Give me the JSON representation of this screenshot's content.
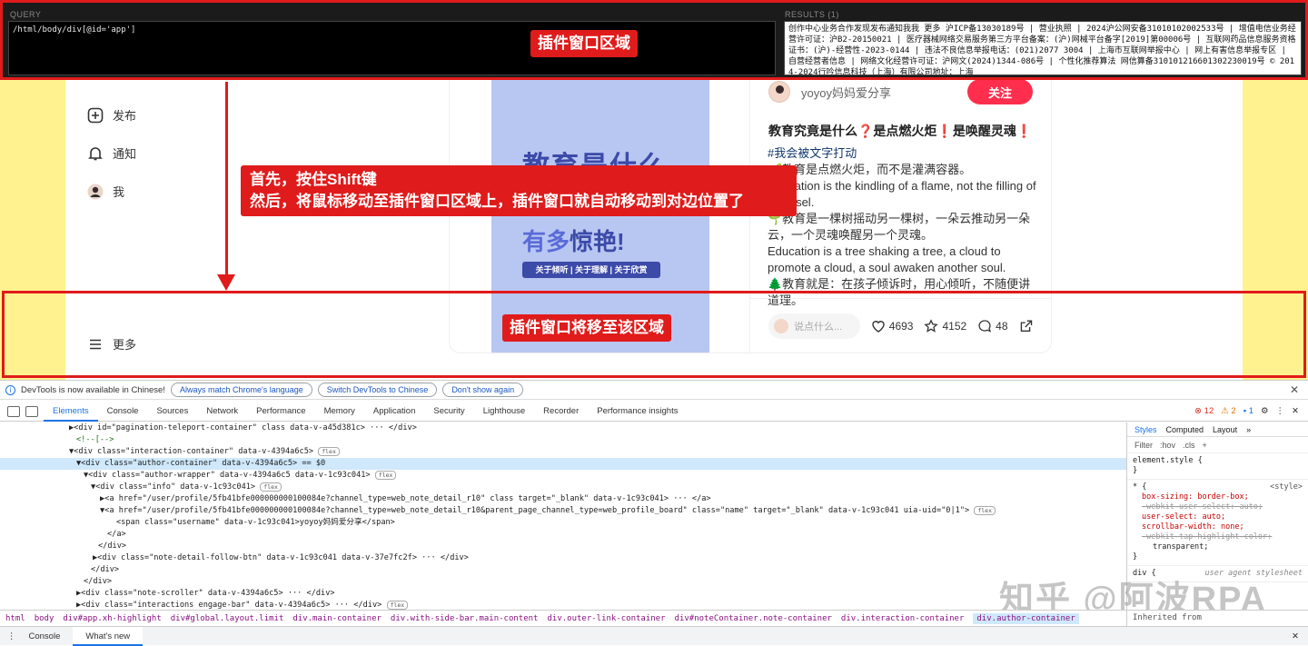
{
  "plugin": {
    "query_label": "QUERY",
    "results_label": "RESULTS (1)",
    "query": "/html/body/div[@id='app']",
    "results": "创作中心业务合作发现发布通知我我 更多 沪ICP备13030189号 | 营业执照 | 2024沪公网安备31010102002533号 | 增值电信业务经营许可证：沪B2-20150021 | 医疗器械网络交易服务第三方平台备案：(沪)网械平台备字[2019]第00006号 | 互联网药品信息服务资格证书：(沪)-经营性-2023-0144 | 违法不良信息举报电话：(021)2077 3004 | 上海市互联网举报中心 | 网上有害信息举报专区 | 自营经营者信息 | 网络文化经营许可证：沪网文(2024)1344-086号 | 个性化推荐算法 网信算备310101216601302230019号 © 2014-2024行吟信息科技（上海）有限公司地址：上海"
  },
  "annotations": {
    "plugin_area": "插件窗口区域",
    "instruction_line1": "首先，按住Shift键",
    "instruction_line2": "然后，将鼠标移动至插件窗口区域上，插件窗口就自动移动到对边位置了",
    "target_area": "插件窗口将移至该区域"
  },
  "sidebar": {
    "items": [
      {
        "label": "发布",
        "icon": "plus-square-icon"
      },
      {
        "label": "通知",
        "icon": "bell-icon"
      },
      {
        "label": "我",
        "icon": "avatar"
      },
      {
        "label": "更多",
        "icon": "menu-icon"
      }
    ]
  },
  "note": {
    "image_text1": "教育是什么",
    "image_text2a": "有多",
    "image_text2b": "惊艳!",
    "image_pill": "关于倾听 | 关于理解 | 关于欣赏",
    "author": "yoyoy妈妈爱分享",
    "follow": "关注",
    "title": "教育究竟是什么❓是点燃火炬❗是唤醒灵魂❗",
    "hashtag": "#我会被文字打动",
    "body": [
      "🌱教育是点燃火炬，而不是灌满容器。",
      "Education is the kindling of a flame, not the filling of a vessel.",
      "🌱教育是一棵树摇动另一棵树，一朵云推动另一朵云，一个灵魂唤醒另一个灵魂。",
      "Education is a tree shaking a tree, a cloud to promote a cloud, a soul awaken another soul.",
      "🌲教育就是：在孩子倾诉时，用心倾听，不随便讲道理。"
    ],
    "comment_placeholder": "说点什么...",
    "likes": "4693",
    "collects": "4152",
    "comments": "48"
  },
  "devtools": {
    "infobar": {
      "message": "DevTools is now available in Chinese!",
      "btn1": "Always match Chrome's language",
      "btn2": "Switch DevTools to Chinese",
      "btn3": "Don't show again"
    },
    "tabs": [
      "Elements",
      "Console",
      "Sources",
      "Network",
      "Performance",
      "Memory",
      "Application",
      "Security",
      "Lighthouse",
      "Recorder",
      "Performance insights"
    ],
    "errors": "12",
    "warnings": "2",
    "infos": "1",
    "dom_lines": [
      "▶<div id=\"pagination-teleport-container\" class data-v-a45d381c> ··· </div>",
      "<!--[-->",
      "▼<div class=\"interaction-container\" data-v-4394a6c5>",
      "▼<div class=\"author-container\" data-v-4394a6c5> == $0",
      "▼<div class=\"author-wrapper\" data-v-4394a6c5 data-v-1c93c041>",
      "▼<div class=\"info\" data-v-1c93c041>",
      "▶<a href=\"/user/profile/5fb41bfe000000000100084e?channel_type=web_note_detail_r10\" class target=\"_blank\" data-v-1c93c041> ··· </a>",
      "▼<a href=\"/user/profile/5fb41bfe000000000100084e?channel_type=web_note_detail_r10&parent_page_channel_type=web_profile_board\" class=\"name\" target=\"_blank\" data-v-1c93c041 uia-uid=\"0|1\">",
      "<span class=\"username\" data-v-1c93c041>yoyoy妈妈爱分享</span>",
      "</a>",
      "</div>",
      "▶<div class=\"note-detail-follow-btn\" data-v-1c93c041 data-v-37e7fc2f> ··· </div>",
      "</div>",
      "</div>",
      "▶<div class=\"note-scroller\" data-v-4394a6c5> ··· </div>",
      "▶<div class=\"interactions engage-bar\" data-v-4394a6c5> ··· </div>"
    ],
    "styles_tabs": [
      "Styles",
      "Computed",
      "Layout"
    ],
    "filter": "Filter",
    "filter_hov": ":hov",
    "filter_cls": ".cls",
    "rule_element": "element.style {",
    "rule_close": "}",
    "rule_star": "* {",
    "rule_source": "<style>",
    "rule_props": [
      "box-sizing: border-box;",
      "-webkit-user-select: auto;",
      "user-select: auto;",
      "scrollbar-width: none;",
      "-webkit-tap-highlight-color:",
      "transparent;"
    ],
    "rule_div": "div {",
    "rule_div_source": "user agent stylesheet",
    "breadcrumbs": [
      "html",
      "body",
      "div#app.xh-highlight",
      "div#global.layout.limit",
      "div.main-container",
      "div.with-side-bar.main-content",
      "div.outer-link-container",
      "div#noteContainer.note-container",
      "div.interaction-container",
      "div.author-container"
    ],
    "inherited": "Inherited from div#global.layout.limit",
    "drawer_tabs": [
      "Console",
      "What's new"
    ]
  },
  "watermark": "知乎 @阿波RPA",
  "colors": {
    "accent": "#e01b1b",
    "brand": "#ff2e4d",
    "devtools_blue": "#1a73e8"
  }
}
